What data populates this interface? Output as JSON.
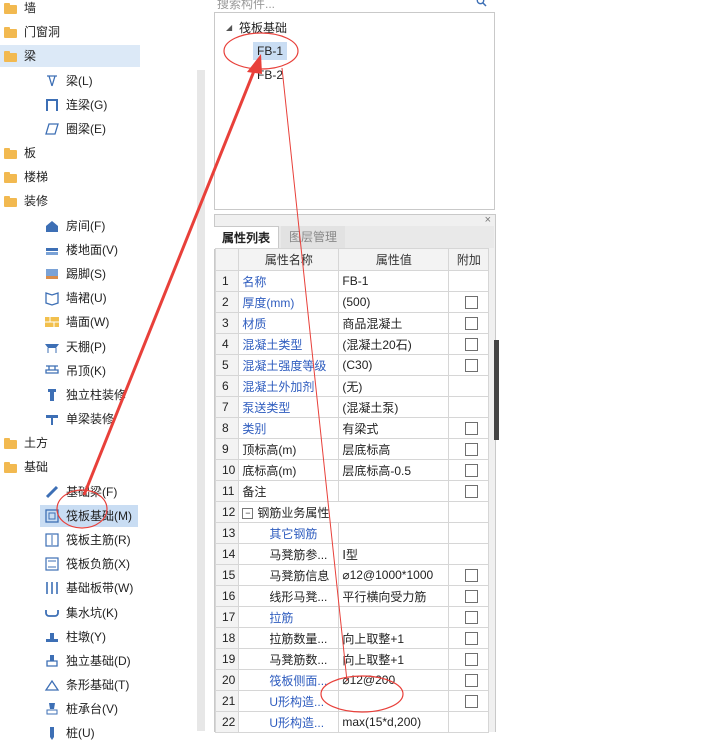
{
  "tree": {
    "nodes": [
      {
        "key": "wall",
        "label": "墙",
        "type": "category",
        "expand": "+"
      },
      {
        "key": "door",
        "label": "门窗洞",
        "type": "category",
        "expand": "+"
      },
      {
        "key": "beam",
        "label": "梁",
        "type": "category",
        "expand": "−",
        "selected": true
      },
      {
        "key": "beam-l",
        "label": "梁(L)",
        "type": "leaf",
        "icon": "beam-icon"
      },
      {
        "key": "beam-g",
        "label": "连梁(G)",
        "type": "leaf",
        "icon": "link-beam-icon"
      },
      {
        "key": "beam-e",
        "label": "圈梁(E)",
        "type": "leaf",
        "icon": "ring-beam-icon"
      },
      {
        "key": "slab",
        "label": "板",
        "type": "category",
        "expand": "+"
      },
      {
        "key": "stair",
        "label": "楼梯",
        "type": "category",
        "expand": "+"
      },
      {
        "key": "deco",
        "label": "装修",
        "type": "category",
        "expand": "−"
      },
      {
        "key": "room",
        "label": "房间(F)",
        "type": "leaf",
        "icon": "room-icon"
      },
      {
        "key": "floor",
        "label": "楼地面(V)",
        "type": "leaf",
        "icon": "floor-icon"
      },
      {
        "key": "skirt",
        "label": "踢脚(S)",
        "type": "leaf",
        "icon": "skirting-icon"
      },
      {
        "key": "dado",
        "label": "墙裙(U)",
        "type": "leaf",
        "icon": "dado-icon"
      },
      {
        "key": "wallface",
        "label": "墙面(W)",
        "type": "leaf",
        "icon": "wall-face-icon"
      },
      {
        "key": "ceiling",
        "label": "天棚(P)",
        "type": "leaf",
        "icon": "ceiling-icon"
      },
      {
        "key": "hang",
        "label": "吊顶(K)",
        "type": "leaf",
        "icon": "suspended-ceiling-icon"
      },
      {
        "key": "colDeco",
        "label": "独立柱装修",
        "type": "leaf",
        "icon": "column-deco-icon"
      },
      {
        "key": "beamDeco",
        "label": "单梁装修",
        "type": "leaf",
        "icon": "beam-deco-icon"
      },
      {
        "key": "earth",
        "label": "土方",
        "type": "category",
        "expand": "+"
      },
      {
        "key": "found",
        "label": "基础",
        "type": "category",
        "expand": "−"
      },
      {
        "key": "fbeam",
        "label": "基础梁(F)",
        "type": "leaf",
        "icon": "foundation-beam-icon"
      },
      {
        "key": "raft",
        "label": "筏板基础(M)",
        "type": "leaf",
        "icon": "raft-foundation-icon",
        "selected": true
      },
      {
        "key": "raftMain",
        "label": "筏板主筋(R)",
        "type": "leaf",
        "icon": "raft-main-rebar-icon"
      },
      {
        "key": "raftNeg",
        "label": "筏板负筋(X)",
        "type": "leaf",
        "icon": "raft-neg-rebar-icon"
      },
      {
        "key": "strip",
        "label": "基础板带(W)",
        "type": "leaf",
        "icon": "strip-icon"
      },
      {
        "key": "pit",
        "label": "集水坑(K)",
        "type": "leaf",
        "icon": "sump-icon"
      },
      {
        "key": "pier",
        "label": "柱墩(Y)",
        "type": "leaf",
        "icon": "pier-icon"
      },
      {
        "key": "iso",
        "label": "独立基础(D)",
        "type": "leaf",
        "icon": "isolated-foundation-icon"
      },
      {
        "key": "stripF",
        "label": "条形基础(T)",
        "type": "leaf",
        "icon": "strip-foundation-icon"
      },
      {
        "key": "cap",
        "label": "桩承台(V)",
        "type": "leaf",
        "icon": "pile-cap-icon"
      },
      {
        "key": "pile",
        "label": "桩(U)",
        "type": "leaf",
        "icon": "pile-icon"
      }
    ]
  },
  "search": {
    "placeholder": "搜索构件..."
  },
  "components": {
    "group_label": "筏板基础",
    "items": [
      "FB-1",
      "FB-2"
    ],
    "selected": "FB-1"
  },
  "props": {
    "tabs": [
      "属性列表",
      "图层管理"
    ],
    "active_tab": "属性列表",
    "headers": [
      "属性名称",
      "属性值",
      "附加"
    ],
    "rows": [
      {
        "n": "1",
        "name": "名称",
        "value": "FB-1",
        "cb": false,
        "blue": true
      },
      {
        "n": "2",
        "name": "厚度(mm)",
        "value": "(500)",
        "cb": true,
        "blue": true
      },
      {
        "n": "3",
        "name": "材质",
        "value": "商品混凝土",
        "cb": true,
        "blue": true
      },
      {
        "n": "4",
        "name": "混凝土类型",
        "value": "(混凝土20石)",
        "cb": true,
        "blue": true
      },
      {
        "n": "5",
        "name": "混凝土强度等级",
        "value": "(C30)",
        "cb": true,
        "blue": true
      },
      {
        "n": "6",
        "name": "混凝土外加剂",
        "value": "(无)",
        "cb": false,
        "blue": true
      },
      {
        "n": "7",
        "name": "泵送类型",
        "value": "(混凝土泵)",
        "cb": false,
        "blue": true
      },
      {
        "n": "8",
        "name": "类别",
        "value": "有梁式",
        "cb": true,
        "blue": true
      },
      {
        "n": "9",
        "name": "顶标高(m)",
        "value": "层底标高",
        "cb": true,
        "blue": false
      },
      {
        "n": "10",
        "name": "底标高(m)",
        "value": "层底标高-0.5",
        "cb": true,
        "blue": false
      },
      {
        "n": "11",
        "name": "备注",
        "value": "",
        "cb": true,
        "blue": false
      },
      {
        "n": "12",
        "name": "钢筋业务属性",
        "value": "",
        "cb": false,
        "blue": false,
        "group": true
      },
      {
        "n": "13",
        "name": "其它钢筋",
        "value": "",
        "cb": false,
        "blue": true,
        "sub": true
      },
      {
        "n": "14",
        "name": "马凳筋参...",
        "value": "Ⅰ型",
        "cb": false,
        "blue": false,
        "sub": true
      },
      {
        "n": "15",
        "name": "马凳筋信息",
        "value": "⌀12@1000*1000",
        "cb": true,
        "blue": false,
        "sub": true
      },
      {
        "n": "16",
        "name": "线形马凳...",
        "value": "平行横向受力筋",
        "cb": true,
        "blue": false,
        "sub": true
      },
      {
        "n": "17",
        "name": "拉筋",
        "value": "",
        "cb": true,
        "blue": true,
        "sub": true
      },
      {
        "n": "18",
        "name": "拉筋数量...",
        "value": "向上取整+1",
        "cb": true,
        "blue": false,
        "sub": true
      },
      {
        "n": "19",
        "name": "马凳筋数...",
        "value": "向上取整+1",
        "cb": true,
        "blue": false,
        "sub": true
      },
      {
        "n": "20",
        "name": "筏板侧面...",
        "value": "⌀12@200",
        "cb": true,
        "blue": true,
        "sub": true
      },
      {
        "n": "21",
        "name": "U形构造...",
        "value": "",
        "cb": true,
        "blue": true,
        "sub": true
      },
      {
        "n": "22",
        "name": "U形构造...",
        "value": "max(15*d,200)",
        "cb": false,
        "blue": true,
        "sub": true
      }
    ]
  },
  "colors": {
    "annotation": "#e8403a",
    "selection": "#c9ddf3",
    "link_text": "#2f5dbf"
  }
}
